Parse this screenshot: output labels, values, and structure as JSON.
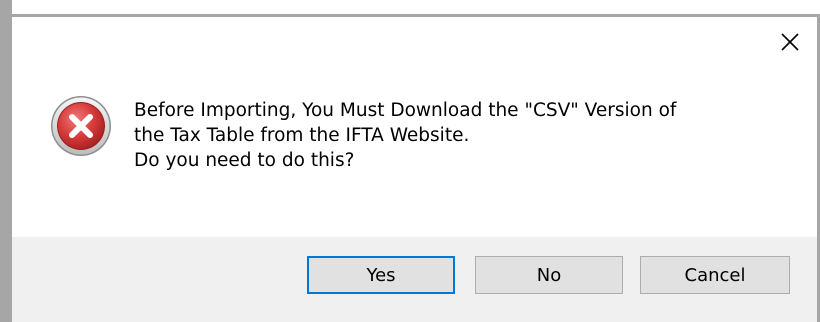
{
  "dialog": {
    "close_icon": "close-icon",
    "error_icon": "error-icon",
    "message_lines": [
      "Before Importing, You Must Download the \"CSV\" Version of",
      "the Tax Table from the IFTA Website.",
      "Do you need to do this?"
    ],
    "buttons": {
      "yes": "Yes",
      "no": "No",
      "cancel": "Cancel"
    },
    "colors": {
      "error_red": "#d63b3b",
      "default_button_border": "#0078d7",
      "footer_bg": "#f0f0f0"
    }
  }
}
